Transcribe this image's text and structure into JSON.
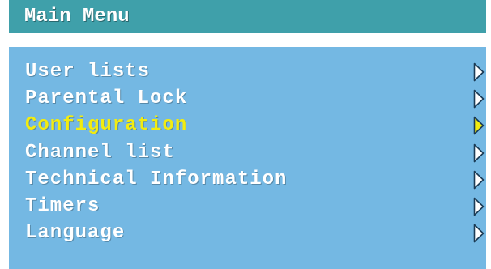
{
  "header": {
    "title": "Main Menu"
  },
  "menu": {
    "items": [
      {
        "label": "User lists",
        "selected": false,
        "icon": "chevron-right-icon"
      },
      {
        "label": "Parental Lock",
        "selected": false,
        "icon": "chevron-right-icon"
      },
      {
        "label": "Configuration",
        "selected": true,
        "icon": "chevron-right-icon"
      },
      {
        "label": "Channel list",
        "selected": false,
        "icon": "chevron-right-icon"
      },
      {
        "label": "Technical Information",
        "selected": false,
        "icon": "chevron-right-icon"
      },
      {
        "label": "Timers",
        "selected": false,
        "icon": "chevron-right-icon"
      },
      {
        "label": "Language",
        "selected": false,
        "icon": "chevron-right-icon"
      }
    ]
  },
  "colors": {
    "title_bar": "#3fa0aa",
    "panel": "#74b8e3",
    "text": "#ffffff",
    "selected_text": "#f2ec10",
    "arrow_fill": "#ffffff",
    "selected_arrow_fill": "#f2ec10",
    "arrow_stroke": "#1b3b55"
  }
}
